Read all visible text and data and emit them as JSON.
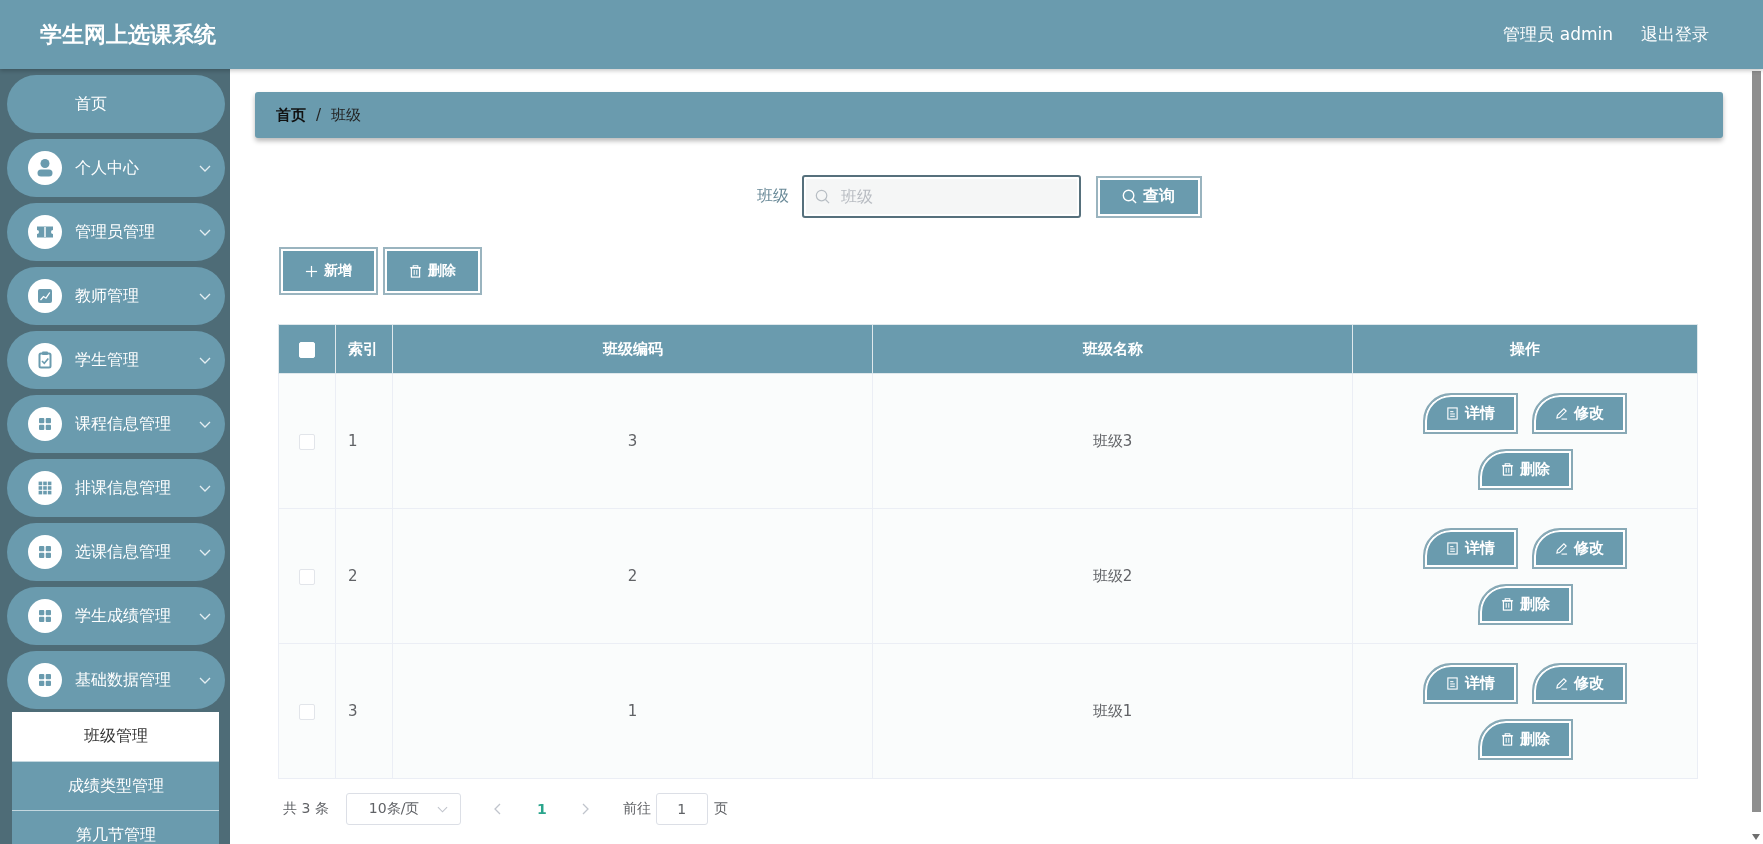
{
  "header": {
    "title": "学生网上选课系统",
    "user": "管理员 admin",
    "logout": "退出登录"
  },
  "sidebar": {
    "items": [
      {
        "kind": "link",
        "label": "首页"
      },
      {
        "kind": "submenu",
        "label": "个人中心"
      },
      {
        "kind": "submenu",
        "label": "管理员管理"
      },
      {
        "kind": "submenu",
        "label": "教师管理"
      },
      {
        "kind": "submenu",
        "label": "学生管理"
      },
      {
        "kind": "submenu",
        "label": "课程信息管理"
      },
      {
        "kind": "submenu",
        "label": "排课信息管理"
      },
      {
        "kind": "submenu",
        "label": "选课信息管理"
      },
      {
        "kind": "submenu",
        "label": "学生成绩管理"
      },
      {
        "kind": "submenu",
        "label": "基础数据管理",
        "expanded": true,
        "children": [
          {
            "label": "班级管理",
            "selected": true
          },
          {
            "label": "成绩类型管理",
            "selected": false
          },
          {
            "label": "第几节管理",
            "selected": false
          }
        ]
      }
    ]
  },
  "breadcrumb": {
    "separator": "/",
    "items": [
      {
        "kind": "link",
        "label": "首页"
      },
      {
        "kind": "current",
        "label": "班级"
      }
    ]
  },
  "search": {
    "label": "班级",
    "placeholder": "班级",
    "button": "查询"
  },
  "toolbar": [
    {
      "kind": "add",
      "label": "新增"
    },
    {
      "kind": "delete",
      "label": "删除"
    }
  ],
  "table": {
    "select_all": {
      "checked": false
    },
    "columns": [
      "索引",
      "班级编码",
      "班级名称",
      "操作"
    ],
    "rows": [
      {
        "checked": false,
        "cells": [
          "1",
          "3",
          "班级3"
        ],
        "actions": [
          {
            "kind": "detail",
            "label": "详情"
          },
          {
            "kind": "edit",
            "label": "修改"
          },
          {
            "kind": "delete",
            "label": "删除"
          }
        ]
      },
      {
        "checked": false,
        "cells": [
          "2",
          "2",
          "班级2"
        ],
        "actions": [
          {
            "kind": "detail",
            "label": "详情"
          },
          {
            "kind": "edit",
            "label": "修改"
          },
          {
            "kind": "delete",
            "label": "删除"
          }
        ]
      },
      {
        "checked": false,
        "cells": [
          "3",
          "1",
          "班级1"
        ],
        "actions": [
          {
            "kind": "detail",
            "label": "详情"
          },
          {
            "kind": "edit",
            "label": "修改"
          },
          {
            "kind": "delete",
            "label": "删除"
          }
        ]
      }
    ]
  },
  "pagination": {
    "total": "共 3 条",
    "page_size": "10条/页",
    "prev_disabled": true,
    "pages": [
      {
        "label": "1",
        "selected": true
      }
    ],
    "next_disabled": true,
    "goto_label": "前往",
    "goto_value": "1",
    "goto_suffix": "页"
  }
}
